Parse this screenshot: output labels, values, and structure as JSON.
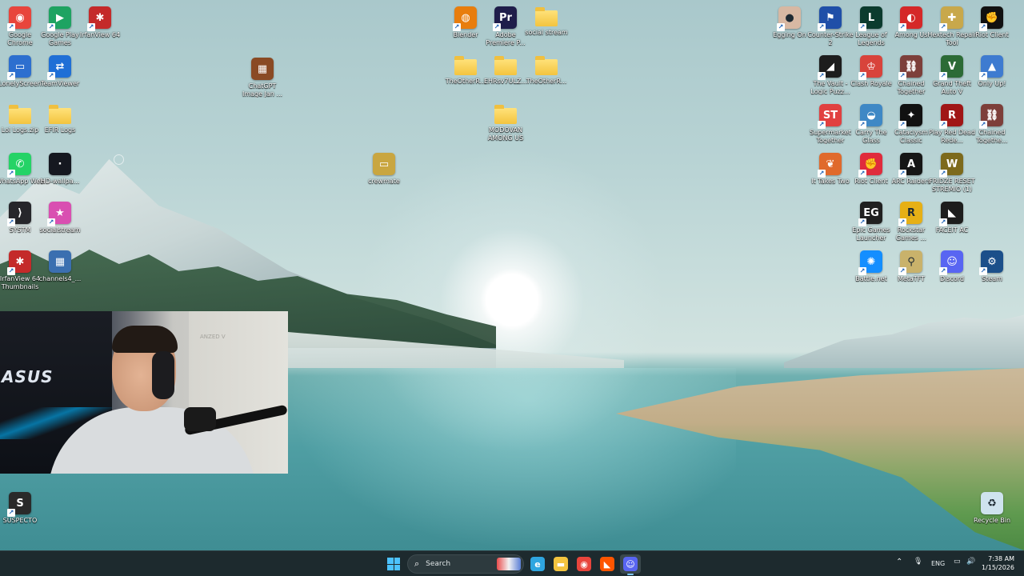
{
  "desktop_icons": [
    {
      "label": "Google Chrome",
      "icon": "chrome-icon",
      "color": "#e8453c",
      "glyph": "◉",
      "shortcut": true,
      "folder": false
    },
    {
      "label": "Google Play Games",
      "icon": "play-games-icon",
      "color": "#1ea362",
      "glyph": "▶",
      "shortcut": true,
      "folder": false
    },
    {
      "label": "IrfanView 64",
      "icon": "irfanview-icon",
      "color": "#c42a2a",
      "glyph": "✱",
      "shortcut": true,
      "folder": false
    },
    {
      "label": "LonelyScreen",
      "icon": "lonelyscreen-icon",
      "color": "#2d6fcf",
      "glyph": "▭",
      "shortcut": true,
      "folder": false
    },
    {
      "label": "TeamViewer",
      "icon": "teamviewer-icon",
      "color": "#1f6fd6",
      "glyph": "⇄",
      "shortcut": true,
      "folder": false
    },
    {
      "label": "Lol Logs.zip",
      "icon": "zip-folder-icon",
      "color": "#f3c43f",
      "glyph": "",
      "shortcut": false,
      "folder": true
    },
    {
      "label": "EFIR Logs",
      "icon": "folder-icon",
      "color": "#f3c43f",
      "glyph": "",
      "shortcut": false,
      "folder": true
    },
    {
      "label": "WhatsApp Web",
      "icon": "whatsapp-icon",
      "color": "#25d366",
      "glyph": "✆",
      "shortcut": true,
      "folder": false
    },
    {
      "label": "HD-wallpa...",
      "icon": "image-file-icon",
      "color": "#151820",
      "glyph": "·",
      "shortcut": false,
      "folder": false
    },
    {
      "label": "SYSTM",
      "icon": "systm-icon",
      "color": "#26262b",
      "glyph": "⟩",
      "shortcut": true,
      "folder": false
    },
    {
      "label": "socialstream",
      "icon": "socialstream-icon",
      "color": "#d94fb1",
      "glyph": "★",
      "shortcut": true,
      "folder": false
    },
    {
      "label": "IrfanView 64 Thumbnails",
      "icon": "irfanview-thumbnails-icon",
      "color": "#c42a2a",
      "glyph": "✱",
      "shortcut": true,
      "folder": false
    },
    {
      "label": "channels4_...",
      "icon": "image-file-icon",
      "color": "#3b6fb0",
      "glyph": "▦",
      "shortcut": false,
      "folder": false
    },
    {
      "label": "ChatGPT Image Jan ...",
      "icon": "image-file-icon",
      "color": "#8a4a24",
      "glyph": "▦",
      "shortcut": false,
      "folder": false
    },
    {
      "label": "Blender",
      "icon": "blender-icon",
      "color": "#e87d0d",
      "glyph": "◍",
      "shortcut": true,
      "folder": false
    },
    {
      "label": "Adobe Premiere P...",
      "icon": "premiere-pro-icon",
      "color": "#1f1d4a",
      "glyph": "Pr",
      "shortcut": true,
      "folder": false
    },
    {
      "label": "social stream",
      "icon": "folder-icon",
      "color": "#f3c43f",
      "glyph": "",
      "shortcut": false,
      "folder": true
    },
    {
      "label": "TheOtherR...",
      "icon": "folder-icon",
      "color": "#f3c43f",
      "glyph": "",
      "shortcut": false,
      "folder": true
    },
    {
      "label": "EHRsv7ULZ...",
      "icon": "folder-icon",
      "color": "#f3c43f",
      "glyph": "",
      "shortcut": false,
      "folder": true
    },
    {
      "label": "TheOtherR...",
      "icon": "folder-icon",
      "color": "#f3c43f",
      "glyph": "",
      "shortcut": false,
      "folder": true
    },
    {
      "label": "MODOVAN AMONG US",
      "icon": "folder-icon",
      "color": "#f3c43f",
      "glyph": "",
      "shortcut": false,
      "folder": true
    },
    {
      "label": "crewmate",
      "icon": "image-file-icon",
      "color": "#c9a640",
      "glyph": "▭",
      "shortcut": false,
      "folder": false
    },
    {
      "label": "Egging On",
      "icon": "egging-on-icon",
      "color": "#d7b8a3",
      "glyph": "●",
      "shortcut": true,
      "folder": false
    },
    {
      "label": "Counter-Strike 2",
      "icon": "counter-strike-icon",
      "color": "#1f4fa8",
      "glyph": "⚑",
      "shortcut": true,
      "folder": false
    },
    {
      "label": "League of Legends",
      "icon": "league-of-legends-icon",
      "color": "#0b3b2e",
      "glyph": "L",
      "shortcut": true,
      "folder": false
    },
    {
      "label": "Among Us",
      "icon": "among-us-icon",
      "color": "#d52828",
      "glyph": "◐",
      "shortcut": true,
      "folder": false
    },
    {
      "label": "Hextech Repair Tool",
      "icon": "hextech-icon",
      "color": "#c8a84b",
      "glyph": "✚",
      "shortcut": true,
      "folder": false
    },
    {
      "label": "Riot Client",
      "icon": "riot-client-icon",
      "color": "#111111",
      "glyph": "✊",
      "shortcut": true,
      "folder": false
    },
    {
      "label": "The Vault - Logic Puzz...",
      "icon": "the-vault-icon",
      "color": "#1d1d1d",
      "glyph": "◢",
      "shortcut": true,
      "folder": false
    },
    {
      "label": "Clash Royale",
      "icon": "clash-royale-icon",
      "color": "#d8433b",
      "glyph": "♔",
      "shortcut": true,
      "folder": false
    },
    {
      "label": "Chained Together",
      "icon": "chained-together-icon",
      "color": "#7d3f3a",
      "glyph": "⛓",
      "shortcut": true,
      "folder": false
    },
    {
      "label": "Grand Theft Auto V",
      "icon": "gta-v-icon",
      "color": "#2c6b36",
      "glyph": "V",
      "shortcut": true,
      "folder": false
    },
    {
      "label": "Only Up!",
      "icon": "only-up-icon",
      "color": "#3e7bd0",
      "glyph": "▲",
      "shortcut": true,
      "folder": false
    },
    {
      "label": "Supermarket Together",
      "icon": "supermarket-together-icon",
      "color": "#e14040",
      "glyph": "ST",
      "shortcut": true,
      "folder": false
    },
    {
      "label": "Carry The Glass",
      "icon": "carry-the-glass-icon",
      "color": "#3f88c5",
      "glyph": "◒",
      "shortcut": true,
      "folder": false
    },
    {
      "label": "Cataclysm Classic",
      "icon": "cataclysm-classic-icon",
      "color": "#111111",
      "glyph": "✦",
      "shortcut": true,
      "folder": false
    },
    {
      "label": "Play Red Dead Rede...",
      "icon": "red-dead-icon",
      "color": "#a01616",
      "glyph": "R",
      "shortcut": true,
      "folder": false
    },
    {
      "label": "Chained Togethe...",
      "icon": "chained-together-icon",
      "color": "#7d3f3a",
      "glyph": "⛓",
      "shortcut": true,
      "folder": false
    },
    {
      "label": "It Takes Two",
      "icon": "it-takes-two-icon",
      "color": "#e06a2c",
      "glyph": "❦",
      "shortcut": true,
      "folder": false
    },
    {
      "label": "Riot Client",
      "icon": "riot-client-icon",
      "color": "#e02b3c",
      "glyph": "✊",
      "shortcut": true,
      "folder": false
    },
    {
      "label": "ARC Raiders",
      "icon": "arc-raiders-icon",
      "color": "#161616",
      "glyph": "A",
      "shortcut": true,
      "folder": false
    },
    {
      "label": "FRIDZE RESET STREMIO (1)",
      "icon": "stremio-reset-icon",
      "color": "#7d6a1c",
      "glyph": "W",
      "shortcut": true,
      "folder": false
    },
    {
      "label": "Epic Games Launcher",
      "icon": "epic-games-icon",
      "color": "#202020",
      "glyph": "EG",
      "shortcut": true,
      "folder": false
    },
    {
      "label": "Rockstar Games ...",
      "icon": "rockstar-icon",
      "color": "#e6b016",
      "glyph": "R",
      "shortcut": true,
      "folder": false
    },
    {
      "label": "FACEIT AC",
      "icon": "faceit-icon",
      "color": "#1d1d1d",
      "glyph": "◣",
      "shortcut": true,
      "folder": false
    },
    {
      "label": "Battle.net",
      "icon": "battlenet-icon",
      "color": "#148eff",
      "glyph": "✺",
      "shortcut": true,
      "folder": false
    },
    {
      "label": "MetaTFT",
      "icon": "metatft-icon",
      "color": "#c9b26b",
      "glyph": "⚲",
      "shortcut": true,
      "folder": false
    },
    {
      "label": "Discord",
      "icon": "discord-icon",
      "color": "#5865f2",
      "glyph": "☺",
      "shortcut": true,
      "folder": false
    },
    {
      "label": "Steam",
      "icon": "steam-icon",
      "color": "#1b4f8a",
      "glyph": "⚙",
      "shortcut": true,
      "folder": false
    },
    {
      "label": "SUSPECTO",
      "icon": "suspecto-icon",
      "color": "#2a2a2a",
      "glyph": "S",
      "shortcut": true,
      "folder": false
    },
    {
      "label": "Recycle Bin",
      "icon": "recycle-bin-icon",
      "color": "#cfe3ee",
      "glyph": "♻",
      "shortcut": false,
      "folder": false
    }
  ],
  "webcam": {
    "brand_text": "ASUS",
    "door_text": "ANZED V"
  },
  "taskbar": {
    "search_placeholder": "Search",
    "pinned": [
      {
        "name": "edge",
        "icon": "edge-icon",
        "color": "#2fa6e0",
        "glyph": "e"
      },
      {
        "name": "file-explorer",
        "icon": "file-explorer-icon",
        "color": "#f3c43f",
        "glyph": "▬"
      },
      {
        "name": "chrome",
        "icon": "chrome-icon",
        "color": "#e8453c",
        "glyph": "◉"
      },
      {
        "name": "faceit",
        "icon": "faceit-icon",
        "color": "#ff5500",
        "glyph": "◣"
      },
      {
        "name": "discord",
        "icon": "discord-icon",
        "color": "#5865f2",
        "glyph": "☺"
      }
    ],
    "tray": {
      "language": "ENG",
      "time": "7:38 AM",
      "date": "1/15/2026"
    }
  }
}
